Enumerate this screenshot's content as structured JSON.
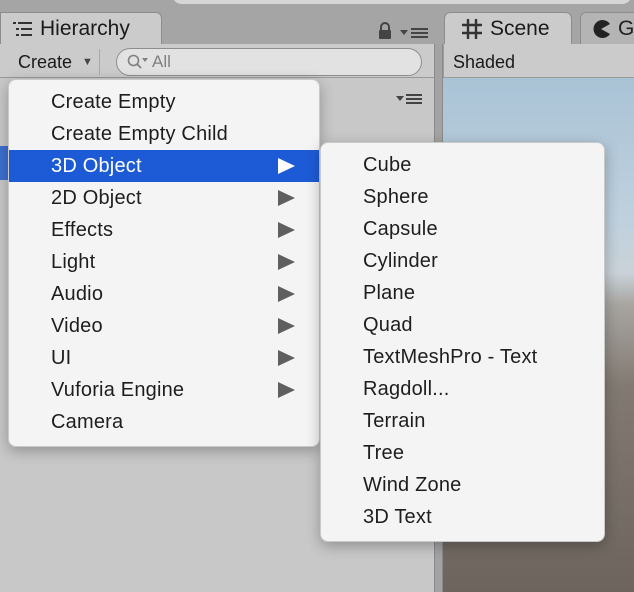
{
  "tabs": {
    "hierarchy": {
      "label": "Hierarchy",
      "icon": "hierarchy-list-icon"
    },
    "scene": {
      "label": "Scene",
      "icon": "scene-grid-icon"
    },
    "game": {
      "label": "G",
      "icon": "game-pacman-icon"
    }
  },
  "hierarchy_toolbar": {
    "create_label": "Create",
    "search_value": "All"
  },
  "scene_toolbar": {
    "shading_mode": "Shaded"
  },
  "create_menu": {
    "items": [
      {
        "label": "Create Empty",
        "has_submenu": false
      },
      {
        "label": "Create Empty Child",
        "has_submenu": false
      },
      {
        "label": "3D Object",
        "has_submenu": true,
        "highlighted": true
      },
      {
        "label": "2D Object",
        "has_submenu": true
      },
      {
        "label": "Effects",
        "has_submenu": true
      },
      {
        "label": "Light",
        "has_submenu": true
      },
      {
        "label": "Audio",
        "has_submenu": true
      },
      {
        "label": "Video",
        "has_submenu": true
      },
      {
        "label": "UI",
        "has_submenu": true
      },
      {
        "label": "Vuforia Engine",
        "has_submenu": true
      },
      {
        "label": "Camera",
        "has_submenu": false
      }
    ]
  },
  "submenu_3d_object": {
    "items": [
      {
        "label": "Cube"
      },
      {
        "label": "Sphere"
      },
      {
        "label": "Capsule"
      },
      {
        "label": "Cylinder"
      },
      {
        "label": "Plane"
      },
      {
        "label": "Quad"
      },
      {
        "label": "TextMeshPro - Text"
      },
      {
        "label": "Ragdoll..."
      },
      {
        "label": "Terrain"
      },
      {
        "label": "Tree"
      },
      {
        "label": "Wind Zone"
      },
      {
        "label": "3D Text"
      }
    ]
  },
  "colors": {
    "highlight": "#1d5bd6",
    "menu_background": "#f4f4f4",
    "panel_background": "#c8c8c8"
  }
}
